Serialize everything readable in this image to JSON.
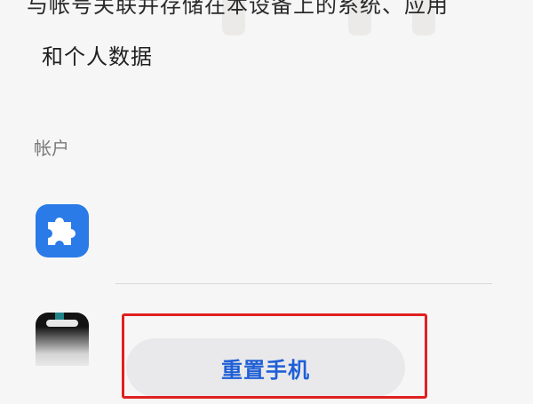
{
  "description": {
    "line1": "与帐号关联并存储在本设备上的系统、应用",
    "line2": "和个人数据"
  },
  "accounts": {
    "header": "帐户",
    "items": [
      {
        "icon": "puzzle-icon",
        "color": "#2a7be8"
      },
      {
        "icon": "tiktok-icon",
        "color": "#131313"
      }
    ]
  },
  "actions": {
    "reset_label": "重置手机",
    "reset_label_color": "#1f5fd6"
  },
  "annotation": {
    "highlight_color": "#e02020"
  }
}
